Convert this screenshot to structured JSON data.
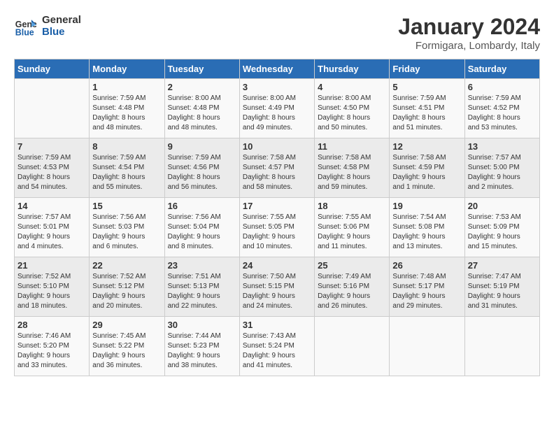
{
  "header": {
    "logo_line1": "General",
    "logo_line2": "Blue",
    "month": "January 2024",
    "location": "Formigara, Lombardy, Italy"
  },
  "columns": [
    "Sunday",
    "Monday",
    "Tuesday",
    "Wednesday",
    "Thursday",
    "Friday",
    "Saturday"
  ],
  "weeks": [
    [
      {
        "day": "",
        "info": ""
      },
      {
        "day": "1",
        "info": "Sunrise: 7:59 AM\nSunset: 4:48 PM\nDaylight: 8 hours\nand 48 minutes."
      },
      {
        "day": "2",
        "info": "Sunrise: 8:00 AM\nSunset: 4:48 PM\nDaylight: 8 hours\nand 48 minutes."
      },
      {
        "day": "3",
        "info": "Sunrise: 8:00 AM\nSunset: 4:49 PM\nDaylight: 8 hours\nand 49 minutes."
      },
      {
        "day": "4",
        "info": "Sunrise: 8:00 AM\nSunset: 4:50 PM\nDaylight: 8 hours\nand 50 minutes."
      },
      {
        "day": "5",
        "info": "Sunrise: 7:59 AM\nSunset: 4:51 PM\nDaylight: 8 hours\nand 51 minutes."
      },
      {
        "day": "6",
        "info": "Sunrise: 7:59 AM\nSunset: 4:52 PM\nDaylight: 8 hours\nand 53 minutes."
      }
    ],
    [
      {
        "day": "7",
        "info": "Sunrise: 7:59 AM\nSunset: 4:53 PM\nDaylight: 8 hours\nand 54 minutes."
      },
      {
        "day": "8",
        "info": "Sunrise: 7:59 AM\nSunset: 4:54 PM\nDaylight: 8 hours\nand 55 minutes."
      },
      {
        "day": "9",
        "info": "Sunrise: 7:59 AM\nSunset: 4:56 PM\nDaylight: 8 hours\nand 56 minutes."
      },
      {
        "day": "10",
        "info": "Sunrise: 7:58 AM\nSunset: 4:57 PM\nDaylight: 8 hours\nand 58 minutes."
      },
      {
        "day": "11",
        "info": "Sunrise: 7:58 AM\nSunset: 4:58 PM\nDaylight: 8 hours\nand 59 minutes."
      },
      {
        "day": "12",
        "info": "Sunrise: 7:58 AM\nSunset: 4:59 PM\nDaylight: 9 hours\nand 1 minute."
      },
      {
        "day": "13",
        "info": "Sunrise: 7:57 AM\nSunset: 5:00 PM\nDaylight: 9 hours\nand 2 minutes."
      }
    ],
    [
      {
        "day": "14",
        "info": "Sunrise: 7:57 AM\nSunset: 5:01 PM\nDaylight: 9 hours\nand 4 minutes."
      },
      {
        "day": "15",
        "info": "Sunrise: 7:56 AM\nSunset: 5:03 PM\nDaylight: 9 hours\nand 6 minutes."
      },
      {
        "day": "16",
        "info": "Sunrise: 7:56 AM\nSunset: 5:04 PM\nDaylight: 9 hours\nand 8 minutes."
      },
      {
        "day": "17",
        "info": "Sunrise: 7:55 AM\nSunset: 5:05 PM\nDaylight: 9 hours\nand 10 minutes."
      },
      {
        "day": "18",
        "info": "Sunrise: 7:55 AM\nSunset: 5:06 PM\nDaylight: 9 hours\nand 11 minutes."
      },
      {
        "day": "19",
        "info": "Sunrise: 7:54 AM\nSunset: 5:08 PM\nDaylight: 9 hours\nand 13 minutes."
      },
      {
        "day": "20",
        "info": "Sunrise: 7:53 AM\nSunset: 5:09 PM\nDaylight: 9 hours\nand 15 minutes."
      }
    ],
    [
      {
        "day": "21",
        "info": "Sunrise: 7:52 AM\nSunset: 5:10 PM\nDaylight: 9 hours\nand 18 minutes."
      },
      {
        "day": "22",
        "info": "Sunrise: 7:52 AM\nSunset: 5:12 PM\nDaylight: 9 hours\nand 20 minutes."
      },
      {
        "day": "23",
        "info": "Sunrise: 7:51 AM\nSunset: 5:13 PM\nDaylight: 9 hours\nand 22 minutes."
      },
      {
        "day": "24",
        "info": "Sunrise: 7:50 AM\nSunset: 5:15 PM\nDaylight: 9 hours\nand 24 minutes."
      },
      {
        "day": "25",
        "info": "Sunrise: 7:49 AM\nSunset: 5:16 PM\nDaylight: 9 hours\nand 26 minutes."
      },
      {
        "day": "26",
        "info": "Sunrise: 7:48 AM\nSunset: 5:17 PM\nDaylight: 9 hours\nand 29 minutes."
      },
      {
        "day": "27",
        "info": "Sunrise: 7:47 AM\nSunset: 5:19 PM\nDaylight: 9 hours\nand 31 minutes."
      }
    ],
    [
      {
        "day": "28",
        "info": "Sunrise: 7:46 AM\nSunset: 5:20 PM\nDaylight: 9 hours\nand 33 minutes."
      },
      {
        "day": "29",
        "info": "Sunrise: 7:45 AM\nSunset: 5:22 PM\nDaylight: 9 hours\nand 36 minutes."
      },
      {
        "day": "30",
        "info": "Sunrise: 7:44 AM\nSunset: 5:23 PM\nDaylight: 9 hours\nand 38 minutes."
      },
      {
        "day": "31",
        "info": "Sunrise: 7:43 AM\nSunset: 5:24 PM\nDaylight: 9 hours\nand 41 minutes."
      },
      {
        "day": "",
        "info": ""
      },
      {
        "day": "",
        "info": ""
      },
      {
        "day": "",
        "info": ""
      }
    ]
  ]
}
